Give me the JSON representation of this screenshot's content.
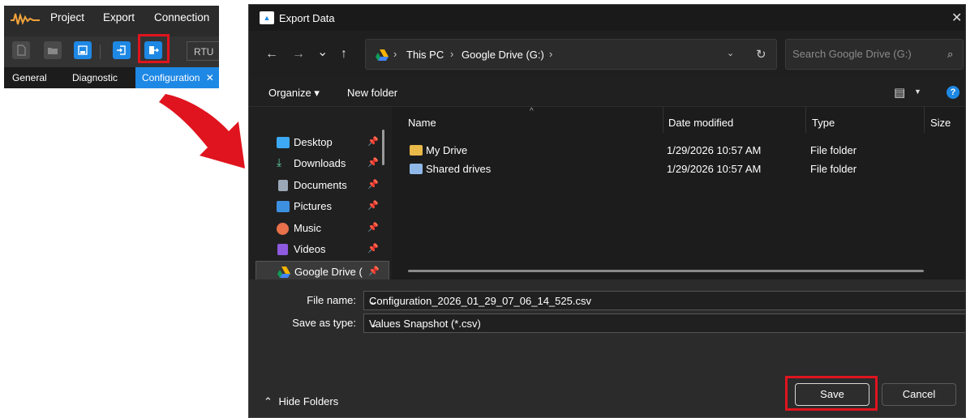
{
  "app": {
    "menu": [
      "Project",
      "Export",
      "Connection"
    ],
    "rtu_label": "RTU",
    "tabs": {
      "general": "General",
      "diagnostic": "Diagnostic",
      "configuration": "Configuration",
      "close": "✕"
    },
    "icons": [
      "new-file-icon",
      "open-folder-icon",
      "save-icon",
      "import-icon",
      "export-icon"
    ]
  },
  "dialog": {
    "title": "Export Data",
    "close": "✕",
    "nav": {
      "back": "←",
      "forward": "→",
      "recent": "⌄",
      "up": "↑"
    },
    "breadcrumb": [
      "This PC",
      "Google Drive (G:)"
    ],
    "breadcrumb_sep": "›",
    "search_placeholder": "Search Google Drive (G:)",
    "commands": {
      "organize": "Organize ▾",
      "new_folder": "New folder"
    },
    "sidebar": [
      {
        "label": "Desktop",
        "icon": "desktop-icon",
        "color": "#3da9f5",
        "pinned": true
      },
      {
        "label": "Downloads",
        "icon": "download-icon",
        "color": "#5fd3a6",
        "pinned": true
      },
      {
        "label": "Documents",
        "icon": "document-icon",
        "color": "#9aa8b8",
        "pinned": true
      },
      {
        "label": "Pictures",
        "icon": "pictures-icon",
        "color": "#3d8fe0",
        "pinned": true
      },
      {
        "label": "Music",
        "icon": "music-icon",
        "color": "#e8704a",
        "pinned": true
      },
      {
        "label": "Videos",
        "icon": "videos-icon",
        "color": "#8e5ae0",
        "pinned": true
      },
      {
        "label": "Google Drive (",
        "icon": "google-drive-icon",
        "color": "#f4b400",
        "pinned": true,
        "selected": true
      }
    ],
    "columns": [
      "Name",
      "Date modified",
      "Type",
      "Size"
    ],
    "files": [
      {
        "name": "My Drive",
        "date": "1/29/2026 10:57 AM",
        "type": "File folder"
      },
      {
        "name": "Shared drives",
        "date": "1/29/2026 10:57 AM",
        "type": "File folder"
      }
    ],
    "file_name_label": "File name:",
    "file_name": "Configuration_2026_01_29_07_06_14_525.csv",
    "save_type_label": "Save as type:",
    "save_type": "Values Snapshot (*.csv)",
    "hide_folders": "Hide Folders",
    "save_button": "Save",
    "cancel_button": "Cancel"
  },
  "colors": {
    "highlight": "#e0141e",
    "accent": "#1e88e5"
  }
}
